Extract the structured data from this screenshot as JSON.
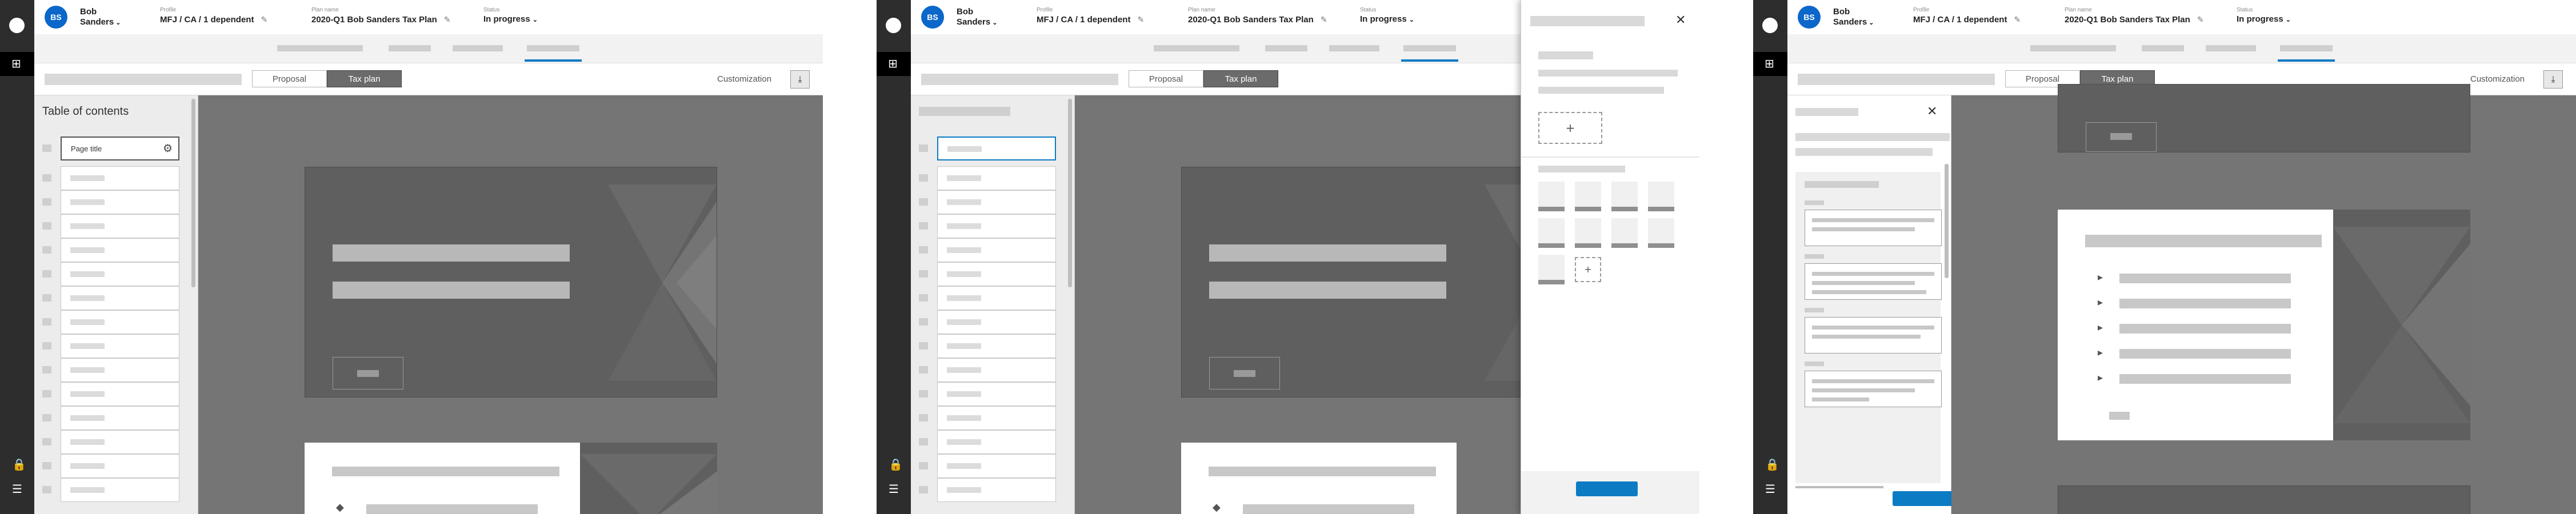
{
  "header": {
    "avatar_initials": "BS",
    "client_first": "Bob",
    "client_last": "Sanders",
    "profile_label": "Profile",
    "profile_value": "MFJ / CA / 1 dependent",
    "plan_label": "Plan name",
    "plan_value": "2020-Q1 Bob Sanders Tax Plan",
    "status_label": "Status",
    "status_value": "In progress"
  },
  "toolbar": {
    "segment_proposal": "Proposal",
    "segment_taxplan": "Tax plan",
    "customization": "Customization"
  },
  "toc": {
    "title": "Table of contents",
    "first_placeholder": "Page title"
  },
  "icons": {
    "grid": "grid-icon",
    "lock": "lock-icon",
    "menu": "list-menu-icon",
    "edit": "pencil-icon",
    "gear": "gear-icon",
    "close": "close-icon",
    "download": "download-icon",
    "add": "plus-icon"
  },
  "colors": {
    "accent": "#0b7bc4",
    "avatar": "#0b67c9",
    "rail": "#2d2d2d"
  }
}
